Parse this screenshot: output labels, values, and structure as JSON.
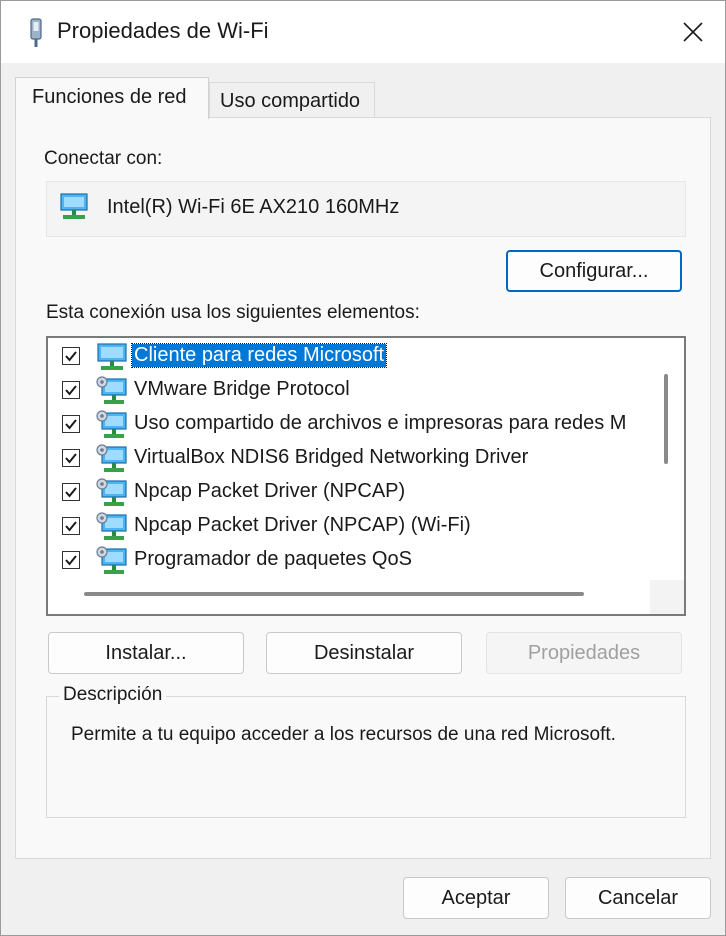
{
  "window": {
    "title": "Propiedades de Wi-Fi"
  },
  "tabs": [
    {
      "label": "Funciones de red",
      "active": true
    },
    {
      "label": "Uso compartido",
      "active": false
    }
  ],
  "connect": {
    "label": "Conectar con:",
    "adapter": "Intel(R) Wi-Fi 6E AX210 160MHz",
    "configure_label": "Configurar..."
  },
  "items_label": "Esta conexión usa los siguientes elementos:",
  "items": [
    {
      "label": "Cliente para redes Microsoft",
      "checked": true,
      "selected": true,
      "icon": "network-client-icon"
    },
    {
      "label": "VMware Bridge Protocol",
      "checked": true,
      "selected": false,
      "icon": "network-protocol-icon"
    },
    {
      "label": "Uso compartido de archivos e impresoras para redes M",
      "checked": true,
      "selected": false,
      "icon": "network-service-icon"
    },
    {
      "label": "VirtualBox NDIS6 Bridged Networking Driver",
      "checked": true,
      "selected": false,
      "icon": "network-service-icon"
    },
    {
      "label": "Npcap Packet Driver (NPCAP)",
      "checked": true,
      "selected": false,
      "icon": "network-service-icon"
    },
    {
      "label": "Npcap Packet Driver (NPCAP) (Wi-Fi)",
      "checked": true,
      "selected": false,
      "icon": "network-service-icon"
    },
    {
      "label": "Programador de paquetes QoS",
      "checked": true,
      "selected": false,
      "icon": "network-service-icon"
    }
  ],
  "actions": {
    "install_label": "Instalar...",
    "uninstall_label": "Desinstalar",
    "properties_label": "Propiedades"
  },
  "description": {
    "legend": "Descripción",
    "text": "Permite a tu equipo acceder a los recursos de una red Microsoft."
  },
  "footer": {
    "ok_label": "Aceptar",
    "cancel_label": "Cancelar"
  },
  "colors": {
    "selection": "#0078d7",
    "primary_border": "#0067c0",
    "window_bg": "#f0f0f0"
  }
}
